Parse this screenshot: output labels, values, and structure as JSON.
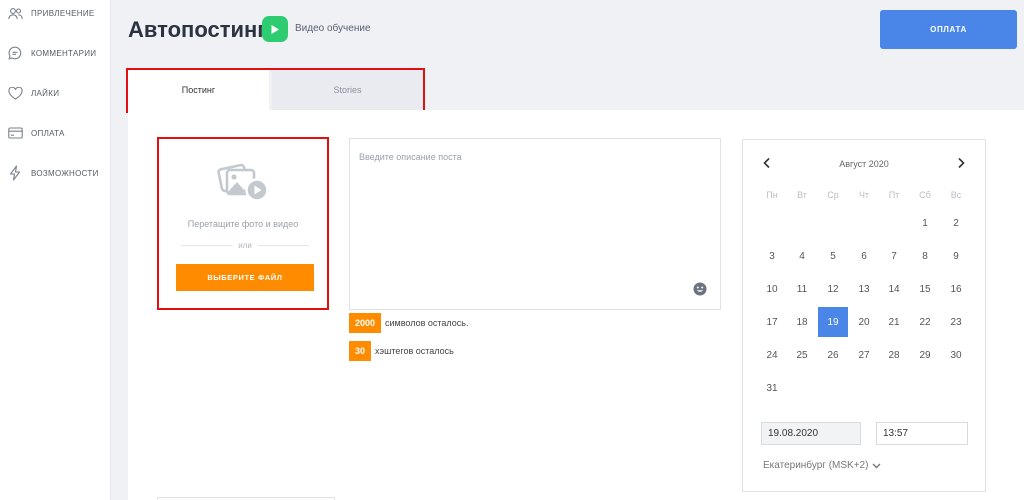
{
  "sidebar": {
    "items": [
      {
        "label": "ПРИВЛЕЧЕНИЕ",
        "icon": "users-icon"
      },
      {
        "label": "КОММЕНТАРИИ",
        "icon": "chat-icon"
      },
      {
        "label": "ЛАЙКИ",
        "icon": "heart-icon"
      },
      {
        "label": "ОПЛАТА",
        "icon": "card-icon"
      },
      {
        "label": "ВОЗМОЖНОСТИ",
        "icon": "lightning-icon"
      }
    ]
  },
  "header": {
    "title": "Автопостинг",
    "video_label": "Видео обучение",
    "pay_label": "ОПЛАТА"
  },
  "tabs": [
    {
      "label": "Постинг",
      "active": true
    },
    {
      "label": "Stories",
      "active": false
    }
  ],
  "upload": {
    "hint": "Перетащите фото и видео",
    "or": "или",
    "button": "ВЫБЕРИТЕ ФАЙЛ"
  },
  "post": {
    "placeholder": "Введите описание поста",
    "value": ""
  },
  "counters": [
    {
      "value": "2000",
      "text": "символов осталось."
    },
    {
      "value": "30",
      "text": "хэштегов осталось"
    }
  ],
  "calendar": {
    "month": "Август 2020",
    "weekdays": [
      "Пн",
      "Вт",
      "Ср",
      "Чт",
      "Пт",
      "Сб",
      "Вс"
    ],
    "first_weekday_index": 5,
    "days_in_month": 31,
    "selected_day": 19,
    "date_value": "19.08.2020",
    "time_value": "13:57",
    "timezone": "Екатеринбург (MSK+2)"
  },
  "colors": {
    "accent_blue": "#4a86e8",
    "accent_orange": "#ff8c00",
    "accent_green": "#2ecc71",
    "highlight_red": "#e01010"
  }
}
